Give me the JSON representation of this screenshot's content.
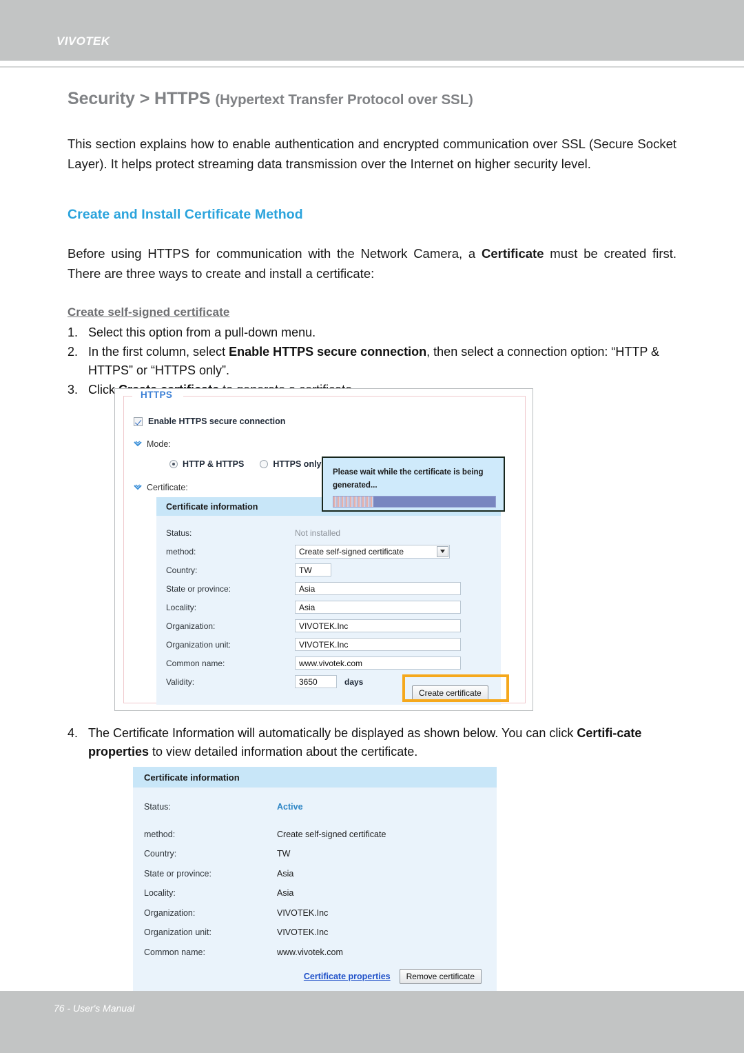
{
  "header": {
    "brand": "VIVOTEK"
  },
  "title": {
    "main": "Security >  HTTPS ",
    "sub": "(Hypertext Transfer Protocol over SSL)"
  },
  "intro": "This section explains how to enable authentication and encrypted communication over SSL (Secure Socket Layer). It helps protect streaming data transmission over the Internet on higher security level.",
  "section": {
    "heading": "Create and Install Certificate Method",
    "paragraph_a": "Before using HTTPS for communication with the Network Camera, a ",
    "paragraph_bold": "Certificate",
    "paragraph_b": " must be created first. There are three ways to create and install a certificate:",
    "subheading": "Create self-signed certificate"
  },
  "steps": {
    "s1_num": "1.",
    "s1_text": "Select this option from a pull-down menu.",
    "s2_num": "2.",
    "s2_a": "In the first column, select ",
    "s2_bold": "Enable HTTPS secure connection",
    "s2_b": ", then select a connection option: “HTTP & HTTPS” or “HTTPS only”.",
    "s3_num": "3.",
    "s3_a": "Click ",
    "s3_bold": "Create certificate",
    "s3_b": " to generate a certificate.",
    "s4_num": "4.",
    "s4_a": "The Certificate Information will automatically be displayed as shown below. You can click ",
    "s4_bold": "Certifi-cate properties",
    "s4_b": " to view detailed information about the certificate."
  },
  "screenshot1": {
    "legend": "HTTPS",
    "enable_checkbox_label": "Enable HTTPS secure connection",
    "mode_label": "Mode:",
    "mode_option_1": "HTTP & HTTPS",
    "mode_option_2": "HTTPS only",
    "certificate_label": "Certificate:",
    "panel_title": "Certificate information",
    "rows": {
      "status_label": "Status:",
      "status_value": "Not installed",
      "method_label": "method:",
      "method_value": "Create self-signed certificate",
      "country_label": "Country:",
      "country_value": "TW",
      "state_label": "State or province:",
      "state_value": "Asia",
      "locality_label": "Locality:",
      "locality_value": "Asia",
      "org_label": "Organization:",
      "org_value": "VIVOTEK.Inc",
      "orgunit_label": "Organization unit:",
      "orgunit_value": "VIVOTEK.Inc",
      "common_label": "Common name:",
      "common_value": "www.vivotek.com",
      "validity_label": "Validity:",
      "validity_value": "3650",
      "validity_unit": "days"
    },
    "create_button": "Create certificate",
    "highlight_color": "#f5a81c"
  },
  "wait_dialog": {
    "line1": "Please wait while the certificate is being",
    "line2": "generated...",
    "progress_color": "#7886c0"
  },
  "screenshot2": {
    "panel_title": "Certificate information",
    "rows": {
      "status_label": "Status:",
      "status_value": "Active",
      "method_label": "method:",
      "method_value": "Create self-signed certificate",
      "country_label": "Country:",
      "country_value": "TW",
      "state_label": "State or province:",
      "state_value": "Asia",
      "locality_label": "Locality:",
      "locality_value": "Asia",
      "org_label": "Organization:",
      "org_value": "VIVOTEK.Inc",
      "orgunit_label": "Organization unit:",
      "orgunit_value": "VIVOTEK.Inc",
      "common_label": "Common name:",
      "common_value": "www.vivotek.com"
    },
    "properties_link": "Certificate properties",
    "remove_button": "Remove certificate",
    "active_color": "#2f86c5"
  },
  "footer": {
    "text": "76 - User's Manual"
  }
}
